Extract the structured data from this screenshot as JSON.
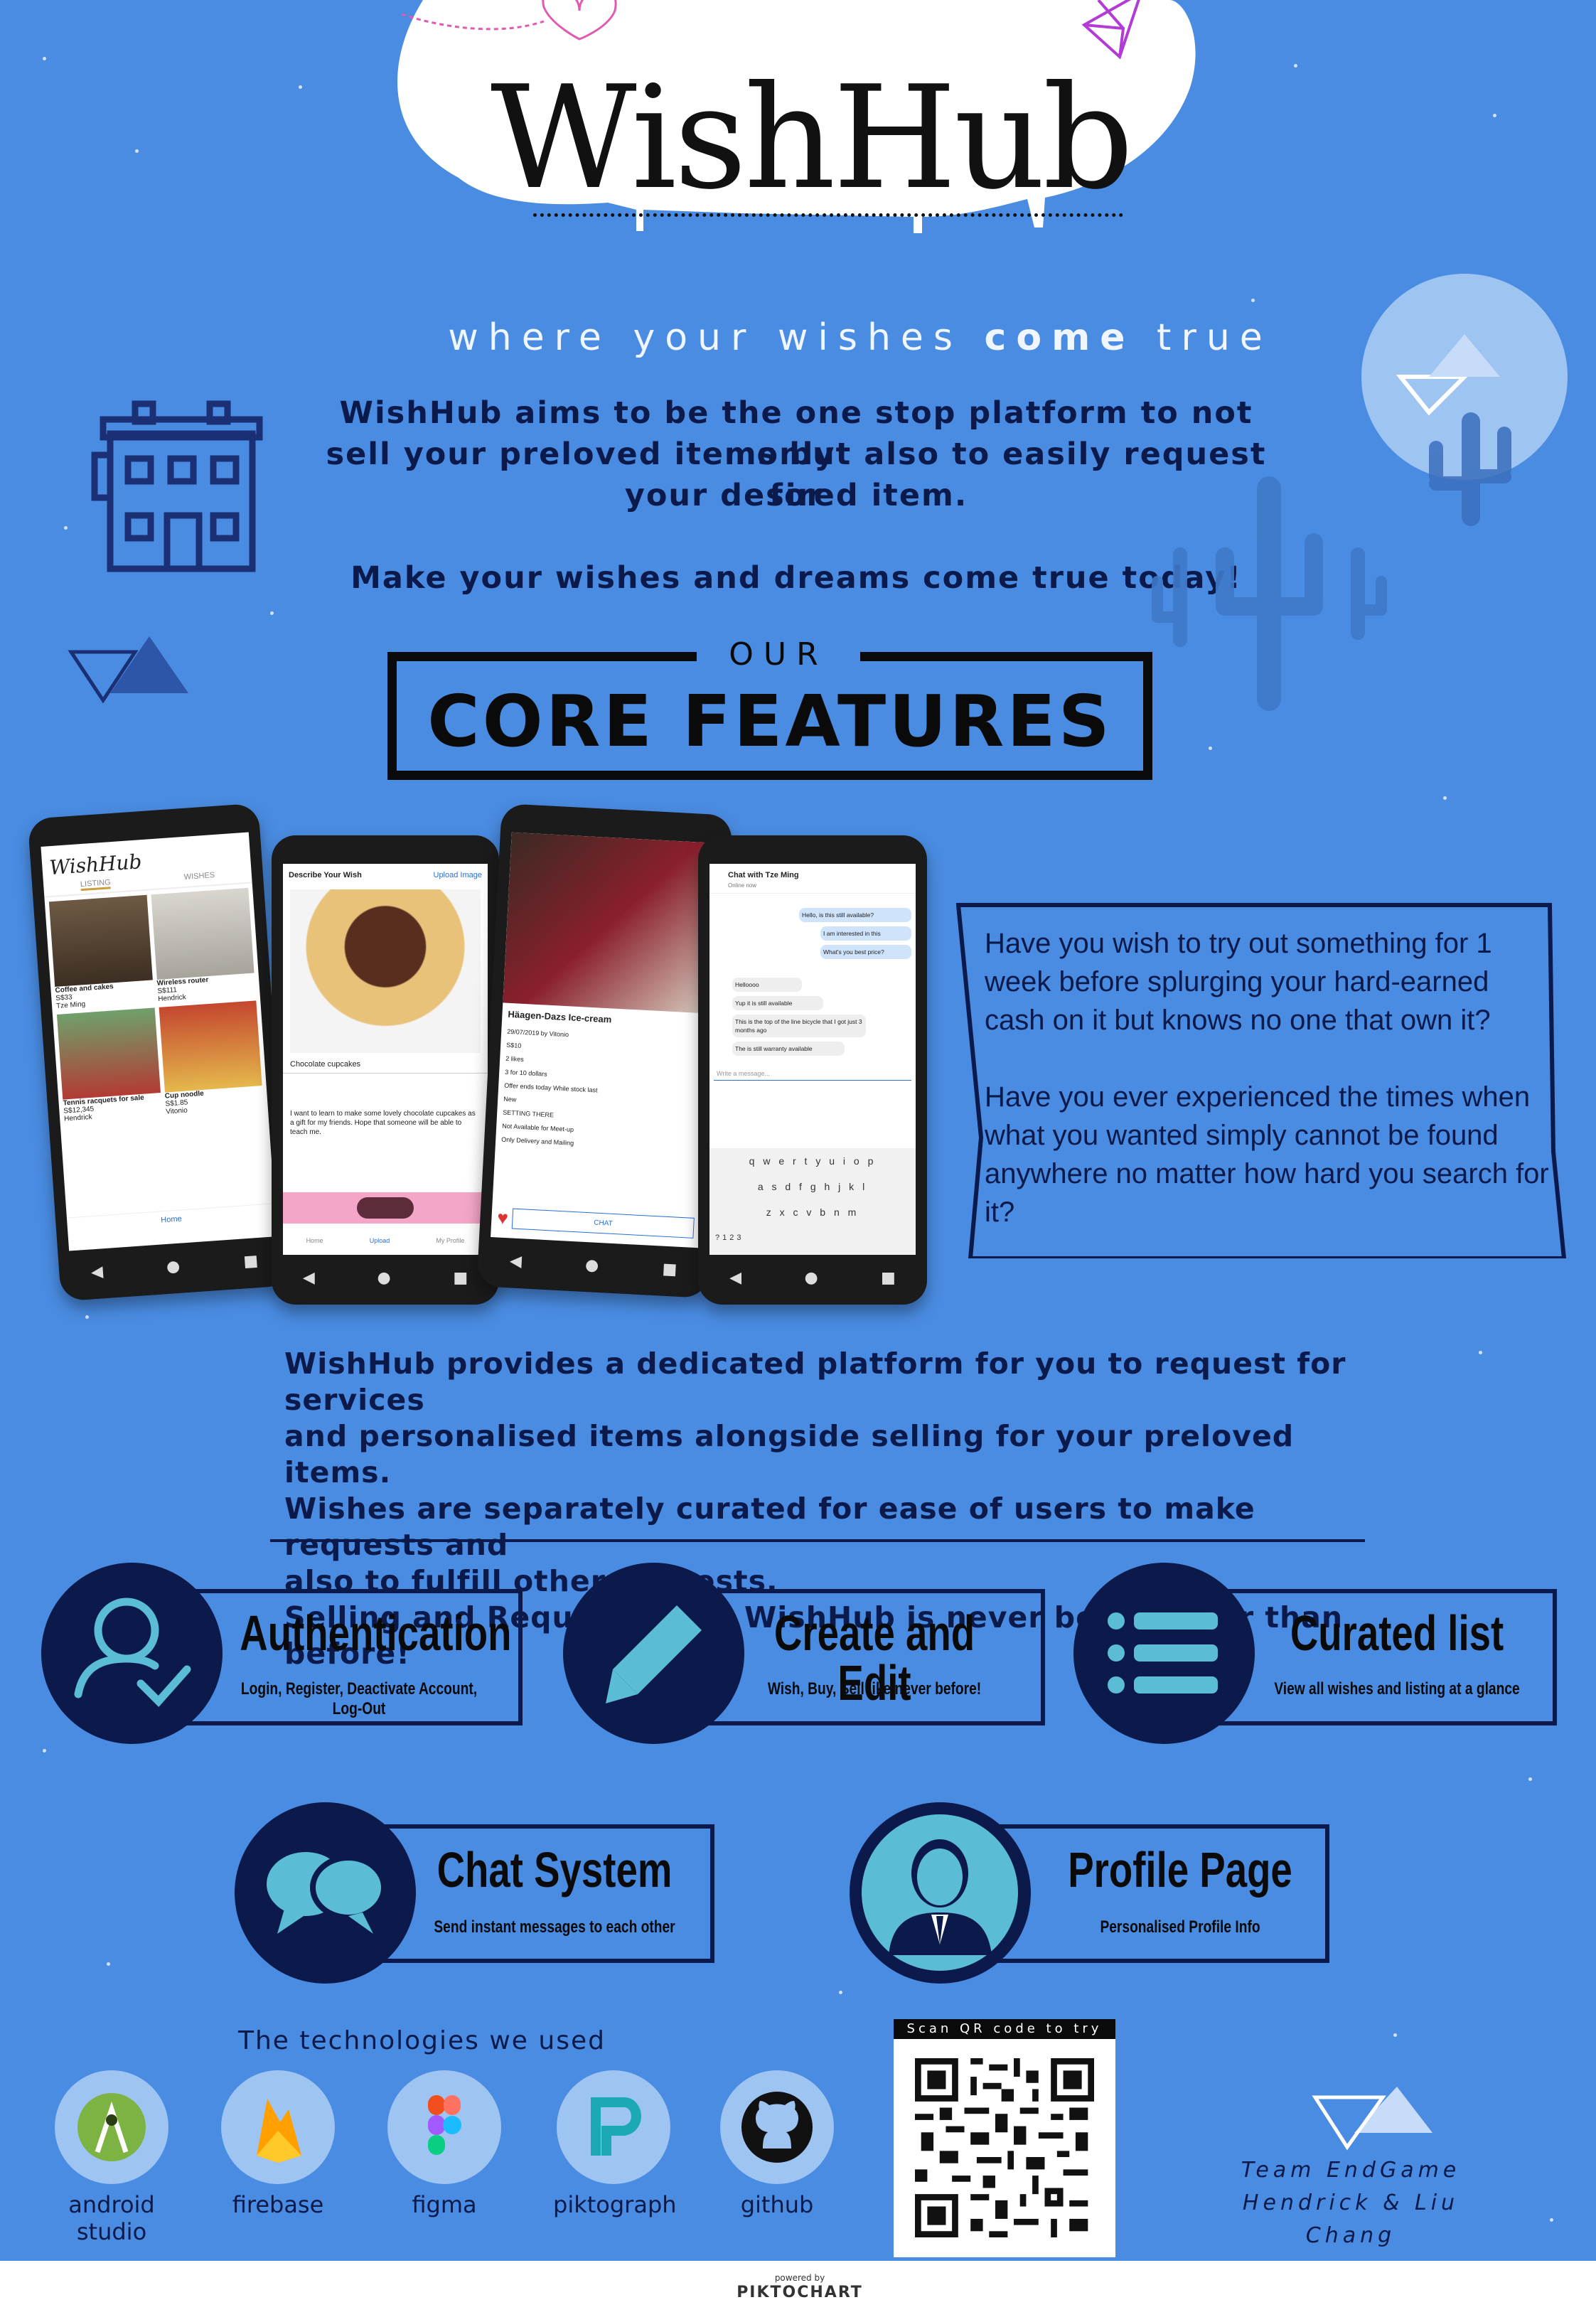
{
  "brand": {
    "name": "WishHub",
    "tagline_pre": "where your wishes ",
    "tagline_bold": "come",
    "tagline_post": " true"
  },
  "intro": {
    "line1": "WishHub aims to be the one stop platform to not only",
    "line2": "sell your preloved items but also to easily request for",
    "line3": "your desired item.",
    "line4": "Make your wishes and dreams come true today!"
  },
  "section": {
    "our": "OUR",
    "title": "CORE FEATURES"
  },
  "phones": {
    "p1": {
      "title": "WishHub",
      "tab1": "LISTING",
      "tab2": "WISHES",
      "item1": "Coffee and cakes",
      "item1_price": "S$33",
      "item1_user": "Tze Ming",
      "item2": "Wireless router",
      "item2_price": "S$111",
      "item2_user": "Hendrick",
      "item3": "Tennis racquets for sale",
      "item3_price": "S$12,345",
      "item3_user": "Hendrick",
      "item4": "Cup noodle",
      "item4_price": "S$1.85",
      "item4_user": "Vitonio",
      "nav": "Home"
    },
    "p2": {
      "header": "Describe Your Wish",
      "upload": "Upload Image",
      "caption": "Chocolate cupcakes",
      "body": "I want to learn to make some lovely chocolate cupcakes as a gift for my friends. Hope that someone will be able to teach me.",
      "nav1": "Home",
      "nav2": "Upload",
      "nav3": "My Profile"
    },
    "p3": {
      "title": "Häagen-Dazs Ice-cream",
      "date": "29/07/2019 by Vitonio",
      "price": "S$10",
      "likes": "2 likes",
      "deal": "3 for 10 dollars",
      "offer": "Offer ends today While stock last",
      "cond": "New",
      "status": "SETTING THERE",
      "meet": "Not Available for Meet-up",
      "delivery": "Only Delivery and Mailing",
      "chat": "CHAT"
    },
    "p4": {
      "title": "Chat with Tze Ming",
      "status": "Online now",
      "m1": "Hello, is this still available?",
      "m2": "I am interested in this",
      "m3": "What's you best price?",
      "r1": "Helloooo",
      "r2": "Yup it is still available",
      "r3": "This is the top of the line bicycle that I got just 3 months ago",
      "r4": "The is still warranty available",
      "placeholder": "Write a message...",
      "row1": "q w e r t y u i o p",
      "row2": "a s d f g h j k l",
      "row3": "z x c v b n m",
      "row4": "?123"
    }
  },
  "speech": {
    "para1": "Have you wish to try out something for 1 week before splurging your hard-earned cash on it but knows no one that own it?",
    "para2": "Have you ever experienced the times when what you wanted simply cannot be found anywhere no matter how hard you search for it?"
  },
  "description": [
    "WishHub provides a dedicated platform for you to request for services",
    "and personalised items alongside selling for your preloved items.",
    "Wishes are separately curated for ease of users to make requests and",
    "also to fulfill other requests.",
    "Selling and Requesting on WishHub is never been easier than before!"
  ],
  "features": [
    {
      "title": "Authentication",
      "subtitle": "Login, Register, Deactivate Account, Log-Out",
      "icon": "user-check-icon"
    },
    {
      "title": "Create and Edit",
      "subtitle": "Wish, Buy, Sell like never before!",
      "icon": "pencil-icon"
    },
    {
      "title": "Curated list",
      "subtitle": "View all wishes and listing at a glance",
      "icon": "list-icon"
    },
    {
      "title": "Chat System",
      "subtitle": "Send instant messages to each other",
      "icon": "chat-bubbles-icon"
    },
    {
      "title": "Profile Page",
      "subtitle": "Personalised Profile Info",
      "icon": "profile-icon"
    }
  ],
  "tech": {
    "heading": "The technologies we used",
    "items": [
      "android studio",
      "firebase",
      "figma",
      "piktograph",
      "github"
    ]
  },
  "qr": {
    "caption": "Scan QR code to try it!"
  },
  "team": {
    "line1": "Team EndGame",
    "line2": "Hendrick & Liu Chang"
  },
  "footer": {
    "powered": "powered by",
    "brand": "PIKTOCHART"
  },
  "colors": {
    "background": "#4a8ce2",
    "navy": "#0b1a4a",
    "circle": "#9ec4f2",
    "accent": "#5bbcd6"
  }
}
